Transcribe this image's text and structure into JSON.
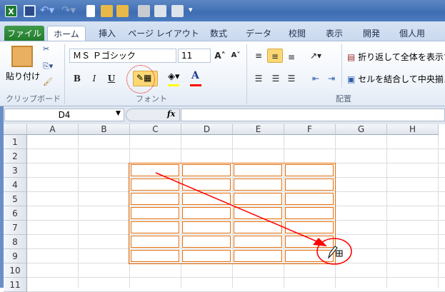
{
  "quick_access": {
    "icons": [
      "excel-icon",
      "save-icon",
      "undo-icon",
      "redo-icon",
      "new-icon",
      "open-icon",
      "folder-icon",
      "calculator-icon",
      "print-preview-icon",
      "print-icon",
      "customize-icon"
    ]
  },
  "tabs": [
    "ファイル",
    "ホーム",
    "挿入",
    "ページ レイアウト",
    "数式",
    "データ",
    "校閲",
    "表示",
    "開発",
    "個人用"
  ],
  "clipboard": {
    "paste": "貼り付け",
    "group_label": "クリップボード"
  },
  "font": {
    "name": "ＭＳ Ｐゴシック",
    "size": "11",
    "bold": "B",
    "italic": "I",
    "underline": "U",
    "font_color_glyph": "A",
    "group_label": "フォント",
    "highlight_color": "#ffff00",
    "font_color": "#ff0000"
  },
  "alignment": {
    "wrap_text": "折り返して全体を表示する",
    "merge_center": "セルを結合して中央揃え",
    "group_label": "配置"
  },
  "formula_bar": {
    "name_box": "D4",
    "fx": "fx",
    "value": ""
  },
  "sheet": {
    "columns": [
      "A",
      "B",
      "C",
      "D",
      "E",
      "F",
      "G",
      "H"
    ],
    "rows": [
      "1",
      "2",
      "3",
      "4",
      "5",
      "6",
      "7",
      "8",
      "9",
      "10",
      "11"
    ],
    "selection_range": "C3:F9",
    "border_color": "#e46c0a"
  },
  "annotation": {
    "arrow_color": "#ff0000"
  }
}
